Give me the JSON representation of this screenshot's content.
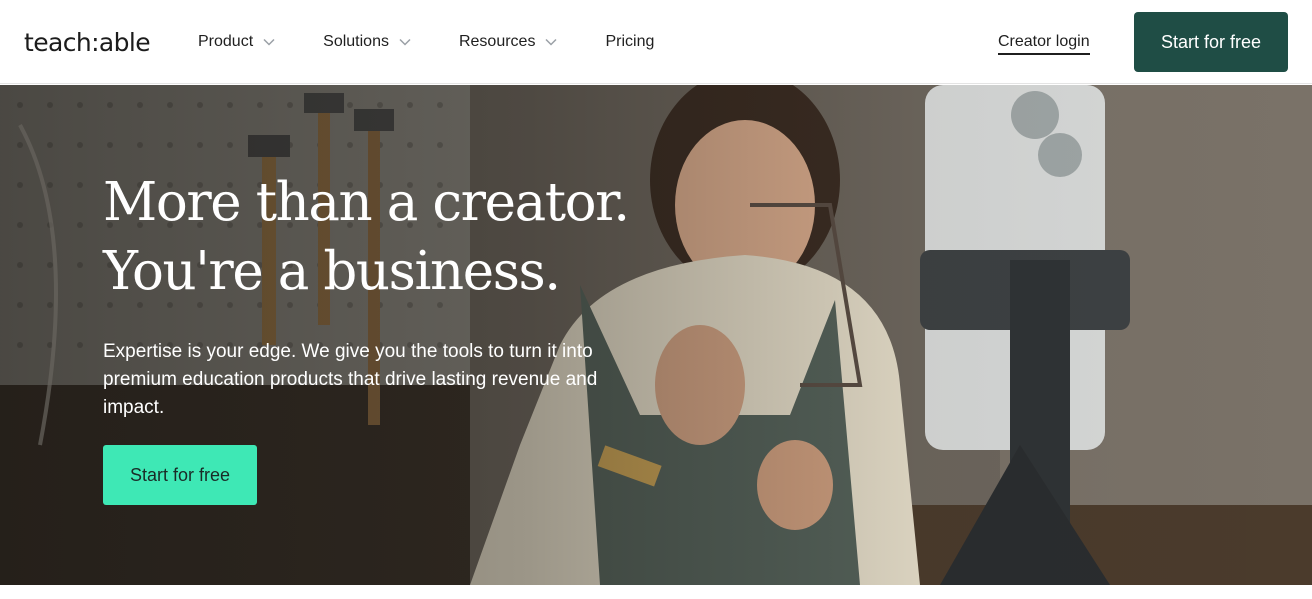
{
  "header": {
    "logo": "teach:able",
    "nav": [
      {
        "label": "Product",
        "has_dropdown": true,
        "icon": "chevron-down-icon"
      },
      {
        "label": "Solutions",
        "has_dropdown": true,
        "icon": "chevron-down-icon"
      },
      {
        "label": "Resources",
        "has_dropdown": true,
        "icon": "chevron-down-icon"
      },
      {
        "label": "Pricing",
        "has_dropdown": false
      }
    ],
    "login_label": "Creator login",
    "cta_label": "Start for free"
  },
  "hero": {
    "title_line1": "More than a creator.",
    "title_line2": "You're a business.",
    "subtitle": "Expertise is your edge. We give you the tools to turn it into premium education products that drive lasting revenue and impact.",
    "cta_label": "Start for free",
    "image_alt": "Jewelry maker filming herself with a smartphone on a tripod in a workshop"
  },
  "colors": {
    "brand_dark": "#1f4d45",
    "accent_mint": "#3ee8b5",
    "text_dark": "#1f1f1f"
  }
}
